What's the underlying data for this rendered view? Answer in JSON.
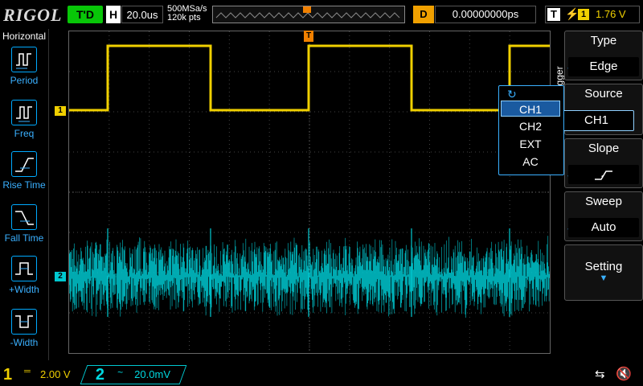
{
  "header": {
    "brand": "RIGOL",
    "run_state": "T'D",
    "timebase_key": "H",
    "timebase_value": "20.0us",
    "sample_rate": "500MSa/s",
    "memory_depth": "120k pts",
    "delay_key": "D",
    "delay_value": "0.00000000ps",
    "trigger_key": "T",
    "trigger_channel": "1",
    "trigger_level": "1.76 V"
  },
  "left_menu": {
    "title": "Horizontal",
    "items": [
      {
        "label": "Period",
        "icon": "period-icon"
      },
      {
        "label": "Freq",
        "icon": "freq-icon"
      },
      {
        "label": "Rise Time",
        "icon": "rise-time-icon"
      },
      {
        "label": "Fall Time",
        "icon": "fall-time-icon"
      },
      {
        "label": "+Width",
        "icon": "plus-width-icon"
      },
      {
        "label": "-Width",
        "icon": "minus-width-icon"
      }
    ]
  },
  "right_menu": {
    "side_label": "Trigger",
    "type": {
      "title": "Type",
      "value": "Edge"
    },
    "source": {
      "title": "Source",
      "value": "CH1"
    },
    "slope": {
      "title": "Slope"
    },
    "sweep": {
      "title": "Sweep",
      "value": "Auto"
    },
    "setting": {
      "title": "Setting"
    }
  },
  "source_popup": {
    "options": [
      "CH1",
      "CH2",
      "EXT",
      "AC"
    ],
    "selected": "CH1"
  },
  "channels": {
    "ch1": {
      "number": "1",
      "scale": "2.00 V",
      "marker": "1",
      "color": "#f0d000"
    },
    "ch2": {
      "number": "2",
      "scale": "20.0mV",
      "marker": "2",
      "color": "#00c8d0"
    }
  },
  "trigger_marker": "T"
}
